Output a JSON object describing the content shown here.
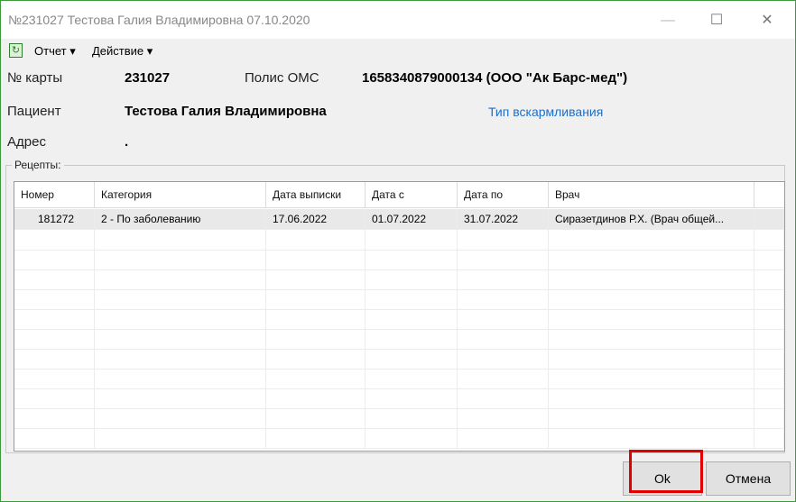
{
  "window": {
    "title": "№231027 Тестова Галия Владимировна 07.10.2020"
  },
  "menu": {
    "report": "Отчет ▾",
    "action": "Действие ▾"
  },
  "card": {
    "card_label": "№ карты",
    "card_value": "231027",
    "policy_label": "Полис ОМС",
    "policy_value": "1658340879000134 (ООО \"Ак Барс-мед\")",
    "patient_label": "Пациент",
    "patient_value": "Тестова Галия Владимировна",
    "feeding_link": "Тип вскармливания",
    "address_label": "Адрес",
    "address_value": "."
  },
  "recipes": {
    "group_label": "Рецепты:",
    "columns": [
      "Номер",
      "Категория",
      "Дата выписки",
      "Дата с",
      "Дата по",
      "Врач"
    ],
    "rows": [
      [
        "181272",
        "2 - По заболеванию",
        "17.06.2022",
        "01.07.2022",
        "31.07.2022",
        "Сиразетдинов Р.Х. (Врач общей..."
      ]
    ]
  },
  "buttons": {
    "ok": "Ok",
    "cancel": "Отмена"
  }
}
